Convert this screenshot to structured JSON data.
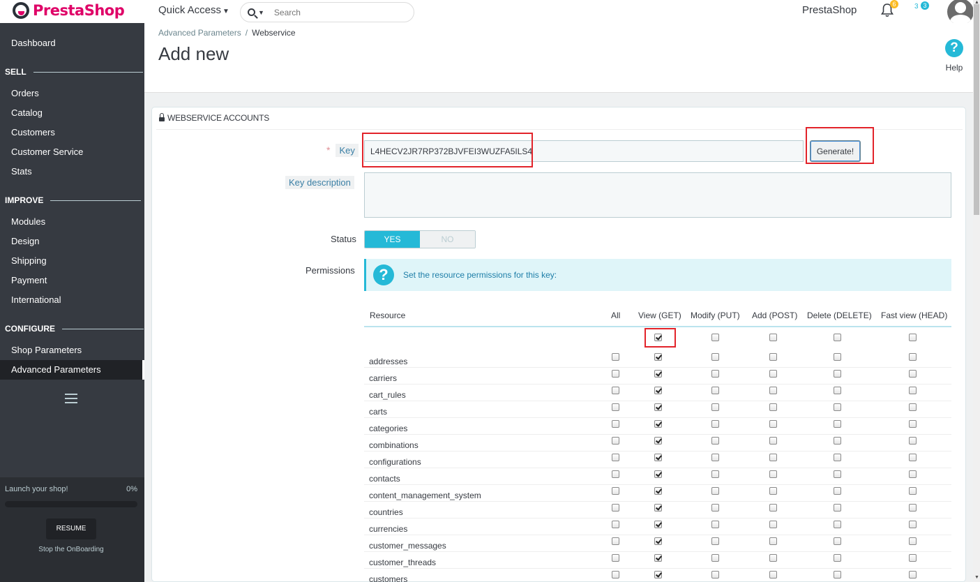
{
  "header": {
    "logo_text": "PrestaShop",
    "quick_access": "Quick Access",
    "search_placeholder": "Search",
    "shop_name": "PrestaShop",
    "notifications_count": "6",
    "messages_count": "3",
    "messages_label": "3"
  },
  "sidebar": {
    "dashboard": "Dashboard",
    "sell": "SELL",
    "sell_items": [
      "Orders",
      "Catalog",
      "Customers",
      "Customer Service",
      "Stats"
    ],
    "improve": "IMPROVE",
    "improve_items": [
      "Modules",
      "Design",
      "Shipping",
      "Payment",
      "International"
    ],
    "configure": "CONFIGURE",
    "configure_items": [
      "Shop Parameters",
      "Advanced Parameters"
    ],
    "active_item": "Advanced Parameters",
    "onboarding": {
      "launch": "Launch your shop!",
      "percent": "0%",
      "progress": 0,
      "resume": "RESUME",
      "stop": "Stop the OnBoarding"
    }
  },
  "page": {
    "breadcrumb": [
      "Advanced Parameters",
      "Webservice"
    ],
    "title": "Add new",
    "help": "Help"
  },
  "panel": {
    "heading": "WEBSERVICE ACCOUNTS",
    "key_label": "Key",
    "key_required": "*",
    "key_value": "L4HECV2JR7RP372BJVFEI3WUZFA5ILS4",
    "generate": "Generate!",
    "key_description_label": "Key description",
    "key_description_value": "",
    "status_label": "Status",
    "status_yes": "YES",
    "status_no": "NO",
    "status_value": "YES",
    "permissions_label": "Permissions",
    "permissions_info": "Set the resource permissions for this key:"
  },
  "permissions": {
    "columns": [
      "Resource",
      "All",
      "View (GET)",
      "Modify (PUT)",
      "Add (POST)",
      "Delete (DELETE)",
      "Fast view (HEAD)"
    ],
    "header_checks": {
      "all": false,
      "view": true,
      "modify": false,
      "add": false,
      "delete": false,
      "head": false
    },
    "rows": [
      {
        "resource": "addresses",
        "all": false,
        "view": true,
        "modify": false,
        "add": false,
        "delete": false,
        "head": false
      },
      {
        "resource": "carriers",
        "all": false,
        "view": true,
        "modify": false,
        "add": false,
        "delete": false,
        "head": false
      },
      {
        "resource": "cart_rules",
        "all": false,
        "view": true,
        "modify": false,
        "add": false,
        "delete": false,
        "head": false
      },
      {
        "resource": "carts",
        "all": false,
        "view": true,
        "modify": false,
        "add": false,
        "delete": false,
        "head": false
      },
      {
        "resource": "categories",
        "all": false,
        "view": true,
        "modify": false,
        "add": false,
        "delete": false,
        "head": false
      },
      {
        "resource": "combinations",
        "all": false,
        "view": true,
        "modify": false,
        "add": false,
        "delete": false,
        "head": false
      },
      {
        "resource": "configurations",
        "all": false,
        "view": true,
        "modify": false,
        "add": false,
        "delete": false,
        "head": false
      },
      {
        "resource": "contacts",
        "all": false,
        "view": true,
        "modify": false,
        "add": false,
        "delete": false,
        "head": false
      },
      {
        "resource": "content_management_system",
        "all": false,
        "view": true,
        "modify": false,
        "add": false,
        "delete": false,
        "head": false
      },
      {
        "resource": "countries",
        "all": false,
        "view": true,
        "modify": false,
        "add": false,
        "delete": false,
        "head": false
      },
      {
        "resource": "currencies",
        "all": false,
        "view": true,
        "modify": false,
        "add": false,
        "delete": false,
        "head": false
      },
      {
        "resource": "customer_messages",
        "all": false,
        "view": true,
        "modify": false,
        "add": false,
        "delete": false,
        "head": false
      },
      {
        "resource": "customer_threads",
        "all": false,
        "view": true,
        "modify": false,
        "add": false,
        "delete": false,
        "head": false
      },
      {
        "resource": "customers",
        "all": false,
        "view": true,
        "modify": false,
        "add": false,
        "delete": false,
        "head": false
      }
    ]
  },
  "icons": {
    "logo": "prestashop-logo-icon",
    "search": "search-icon",
    "bell": "bell-icon",
    "messages": "messages-icon",
    "avatar": "avatar-icon",
    "help": "help-icon",
    "lock": "lock-icon",
    "info": "question-icon",
    "menu": "hamburger-icon"
  },
  "colors": {
    "brand": "#df0067",
    "accent": "#25b9d7",
    "sidebar": "#363a41",
    "highlight": "#e2232a"
  }
}
